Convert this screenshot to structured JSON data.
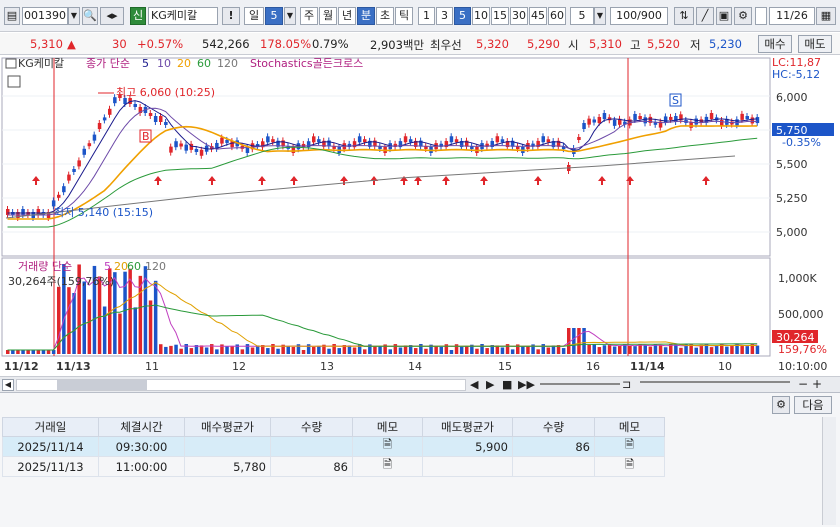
{
  "toolbar": {
    "code": "001390",
    "badge": "신",
    "name": "KG케미칼",
    "excl": "!",
    "period_label": "일",
    "period_value": "5",
    "periods": [
      "주",
      "월",
      "년",
      "분",
      "초",
      "틱"
    ],
    "intervals": [
      "1",
      "3",
      "5",
      "10",
      "15",
      "30",
      "45",
      "60"
    ],
    "interval_sel": "5",
    "count": "100/900",
    "date": "11/26"
  },
  "quote": {
    "price": "5,310",
    "arrow": "▲",
    "change": "30",
    "pct": "+0.57%",
    "volume": "542,266",
    "vol_ratio": "178.05%",
    "turnover": "0.79%",
    "amount": "2,903백만",
    "best_label": "최우선",
    "bid1": "5,320",
    "bid2": "5,290",
    "open_label": "시",
    "open": "5,310",
    "high_label": "고",
    "high": "5,520",
    "low_label": "저",
    "low": "5,230",
    "buy": "매수",
    "sell": "매도"
  },
  "chart": {
    "legend_name": "KG케미칼",
    "legend_ma": "종가 단순",
    "ma_periods": [
      "5",
      "10",
      "20",
      "60",
      "120"
    ],
    "legend_signal": "Stochastics골든크로스",
    "lc": "LC:11,87",
    "hc": "HC:-5,12",
    "high_note": "최고 6,060 (10:25)",
    "low_note": "최저 5,140 (15:15)",
    "price_axis": [
      "6,000",
      "5,750",
      "5,500",
      "5,250",
      "5,000"
    ],
    "current_price": "5,750",
    "current_pct": "-0.35%",
    "vol_legend": "거래량 단순",
    "vol_ma": [
      "5",
      "20",
      "60",
      "120"
    ],
    "vol_value": "30,264주(159,76%)",
    "vol_axis": [
      "1,000K",
      "500,000"
    ],
    "vol_current": "30,264",
    "vol_pct": "159,76%",
    "dates": [
      "11/12",
      "11/13",
      "11",
      "12",
      "13",
      "14",
      "15",
      "16",
      "11/14",
      "10"
    ],
    "time_label": "10:10:00",
    "marker_b": "B",
    "marker_s": "S"
  },
  "panel": {
    "next_btn": "다음",
    "headers": [
      "거래일",
      "체결시간",
      "매수평균가",
      "수량",
      "메모",
      "매도평균가",
      "수량",
      "메모"
    ],
    "rows": [
      [
        "2025/11/14",
        "09:30:00",
        "",
        "",
        "",
        "5,900",
        "86",
        ""
      ],
      [
        "2025/11/13",
        "11:00:00",
        "5,780",
        "86",
        "",
        "",
        "",
        ""
      ]
    ]
  },
  "colors": {
    "up": "#e0262b",
    "down": "#1c55c8",
    "accent": "#3a6fc4"
  }
}
